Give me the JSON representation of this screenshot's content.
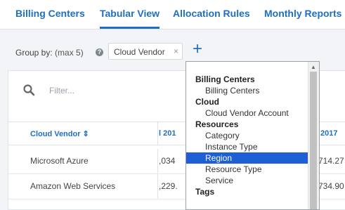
{
  "tabs": [
    {
      "label": "Billing Centers"
    },
    {
      "label": "Tabular View"
    },
    {
      "label": "Allocation Rules"
    },
    {
      "label": "Monthly Reports"
    }
  ],
  "groupby": {
    "label": "Group by:",
    "hint": "(max 5)",
    "help_icon": "?",
    "chip_label": "Cloud Vendor",
    "chip_remove": "×",
    "add_label": "+"
  },
  "filter": {
    "placeholder": "Filter..."
  },
  "table": {
    "headers": [
      "Cloud Vendor ⇕",
      "l 201",
      "2017"
    ],
    "rows": [
      {
        "vendor": "Microsoft Azure",
        "col2": ",034",
        "col3": "714.27"
      },
      {
        "vendor": "Amazon Web Services",
        "col2": ",229.",
        "col3": "734.90"
      }
    ]
  },
  "dropdown": {
    "items": [
      {
        "type": "group",
        "label": "Billing Centers"
      },
      {
        "type": "option",
        "label": "Billing Centers"
      },
      {
        "type": "group",
        "label": "Cloud"
      },
      {
        "type": "option",
        "label": "Cloud Vendor Account"
      },
      {
        "type": "group",
        "label": "Resources"
      },
      {
        "type": "option",
        "label": "Category"
      },
      {
        "type": "option",
        "label": "Instance Type"
      },
      {
        "type": "option",
        "label": "Region",
        "selected": true
      },
      {
        "type": "option",
        "label": "Resource Type"
      },
      {
        "type": "option",
        "label": "Service"
      },
      {
        "type": "group",
        "label": "Tags"
      }
    ]
  },
  "colors": {
    "accent": "#1f6fbf",
    "selection": "#1e5fd6",
    "background": "#f2f4f7"
  }
}
